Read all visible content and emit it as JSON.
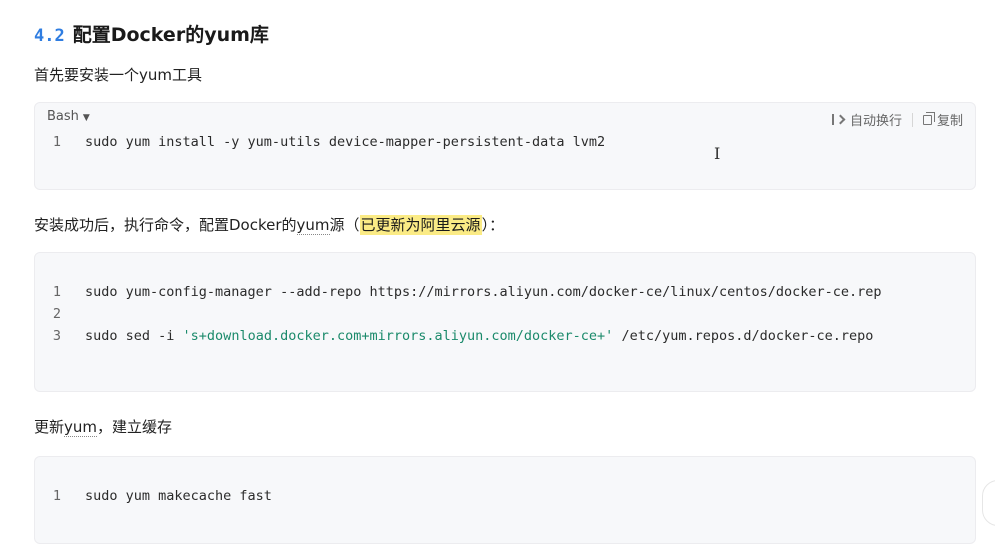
{
  "heading": {
    "number": "4.2",
    "title": "配置Docker的yum库"
  },
  "intro_text": "首先要安装一个yum工具",
  "block1": {
    "language": "Bash",
    "wrap_label": "自动换行",
    "copy_label": "复制",
    "lines": [
      {
        "num": "1",
        "code": "sudo yum install -y yum-utils device-mapper-persistent-data lvm2"
      }
    ]
  },
  "step2_text": {
    "before": "安装成功后，执行命令，配置Docker的",
    "yum": "yum",
    "mid": "源（",
    "highlight": "已更新为阿里云源",
    "after": "）："
  },
  "block2": {
    "lines": [
      {
        "num": "1",
        "code": "sudo yum-config-manager --add-repo https://mirrors.aliyun.com/docker-ce/linux/centos/docker-ce.rep"
      },
      {
        "num": "2",
        "code": ""
      },
      {
        "num": "3",
        "pre": "sudo sed -i ",
        "str": "'s+download.docker.com+mirrors.aliyun.com/docker-ce+'",
        "post": " /etc/yum.repos.d/docker-ce.repo"
      }
    ]
  },
  "step3_text": {
    "before": "更新",
    "yum": "yum",
    "after": "，建立缓存"
  },
  "block3": {
    "lines": [
      {
        "num": "1",
        "code": "sudo yum makecache fast"
      }
    ]
  },
  "cursor_glyph": "I"
}
